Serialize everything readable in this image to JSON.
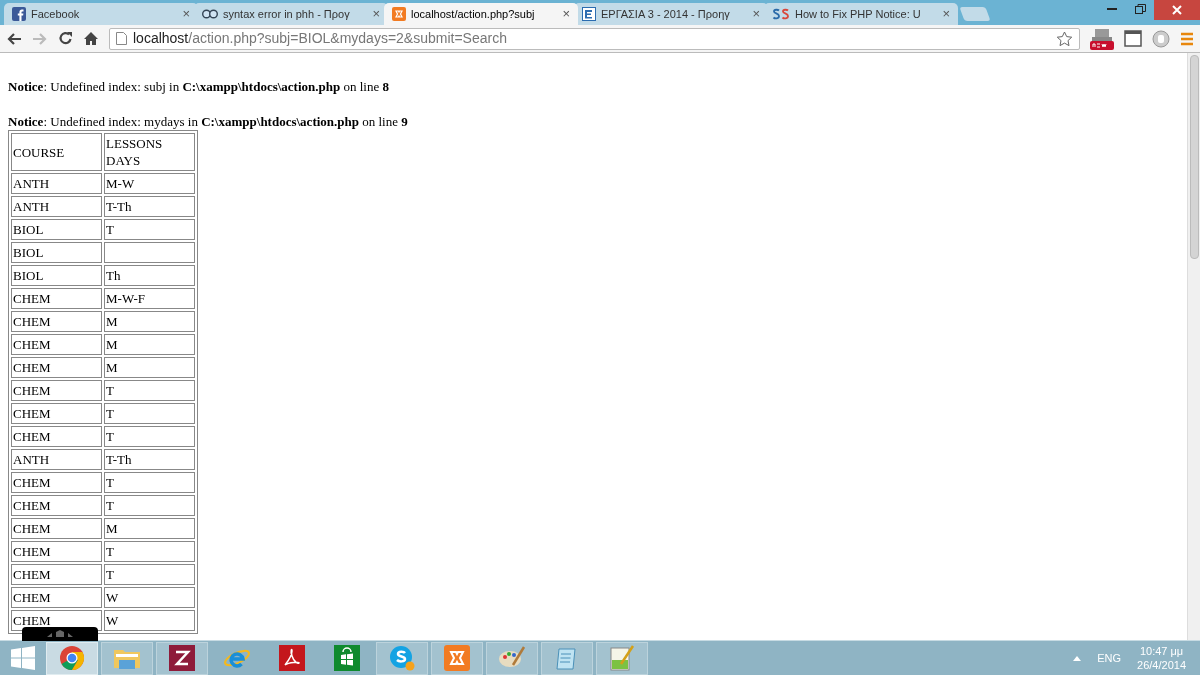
{
  "tabs": [
    {
      "kind": "facebook",
      "title": "Facebook",
      "close": "×",
      "selected": false
    },
    {
      "kind": "goggles",
      "title": "syntax error in phh - Προγ",
      "close": "×",
      "selected": false
    },
    {
      "kind": "xampp",
      "title": "localhost/action.php?subj",
      "close": "×",
      "selected": true
    },
    {
      "kind": "doc",
      "title": "ΕΡΓΑΣΙΑ 3 - 2014 - Προηγ",
      "close": "×",
      "selected": false
    },
    {
      "kind": "ss",
      "title": "How to Fix PHP Notice: U",
      "close": "×",
      "selected": false
    }
  ],
  "address": {
    "host": "localhost",
    "path": "/action.php?subj=BIOL&mydays=2&submit=Search"
  },
  "notices": [
    {
      "label": "Notice",
      "text": ": Undefined index: subj in ",
      "file": "C:\\xampp\\htdocs\\action.php",
      "suffix": " on line ",
      "line": "8"
    },
    {
      "label": "Notice",
      "text": ": Undefined index: mydays in ",
      "file": "C:\\xampp\\htdocs\\action.php",
      "suffix": " on line ",
      "line": "9"
    }
  ],
  "table": {
    "columns": [
      "COURSE",
      "LESSONS DAYS"
    ],
    "rows": [
      [
        "ANTH",
        "M-W"
      ],
      [
        "ANTH",
        "T-Th"
      ],
      [
        "BIOL",
        "T"
      ],
      [
        "BIOL",
        null
      ],
      [
        "BIOL",
        "Th"
      ],
      [
        "CHEM",
        "M-W-F"
      ],
      [
        "CHEM",
        "M"
      ],
      [
        "CHEM",
        "M"
      ],
      [
        "CHEM",
        "M"
      ],
      [
        "CHEM",
        "T"
      ],
      [
        "CHEM",
        "T"
      ],
      [
        "CHEM",
        "T"
      ],
      [
        "ANTH",
        "T-Th"
      ],
      [
        "CHEM",
        "T"
      ],
      [
        "CHEM",
        "T"
      ],
      [
        "CHEM",
        "M"
      ],
      [
        "CHEM",
        "T"
      ],
      [
        "CHEM",
        "T"
      ],
      [
        "CHEM",
        "W"
      ],
      [
        "CHEM",
        "W"
      ]
    ]
  },
  "taskbar": {
    "apps": [
      {
        "kind": "chrome",
        "running": true
      },
      {
        "kind": "explorer",
        "running": true
      },
      {
        "kind": "zend",
        "running": true
      },
      {
        "kind": "ie",
        "running": false
      },
      {
        "kind": "acrobat",
        "running": false
      },
      {
        "kind": "store",
        "running": false
      },
      {
        "kind": "skype",
        "running": true
      },
      {
        "kind": "xampp",
        "running": true
      },
      {
        "kind": "paint",
        "running": true
      },
      {
        "kind": "notepad",
        "running": true
      },
      {
        "kind": "notepadpp",
        "running": true
      }
    ],
    "language": "ENG",
    "time": "10:47 μμ",
    "date": "26/4/2014"
  }
}
